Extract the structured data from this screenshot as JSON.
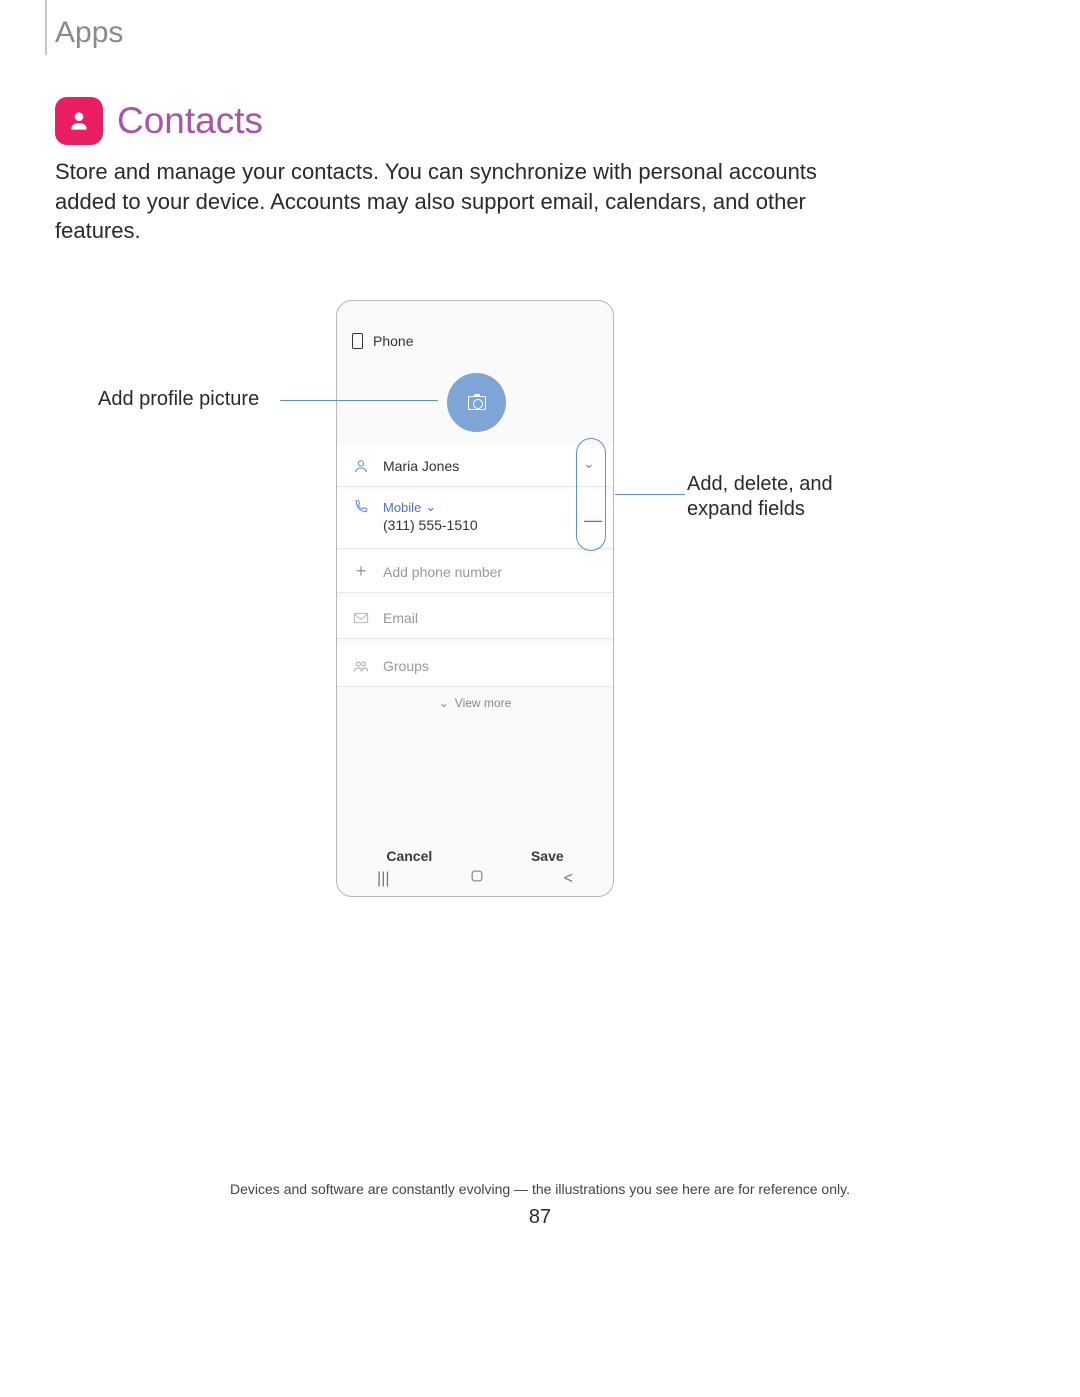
{
  "header": {
    "section": "Apps"
  },
  "title": "Contacts",
  "intro": "Store and manage your contacts. You can synchronize with personal accounts added to your device. Accounts may also support email, calendars, and other features.",
  "callouts": {
    "left": "Add profile picture",
    "right": "Add, delete, and expand fields"
  },
  "phone": {
    "storage": "Phone",
    "name": "Maria Jones",
    "mobile_label": "Mobile",
    "number": "(311) 555-1510",
    "add_phone": "Add phone number",
    "email": "Email",
    "groups": "Groups",
    "view_more": "View more",
    "cancel": "Cancel",
    "save": "Save"
  },
  "footer": "Devices and software are constantly evolving — the illustrations you see here are for reference only.",
  "page_number": "87"
}
